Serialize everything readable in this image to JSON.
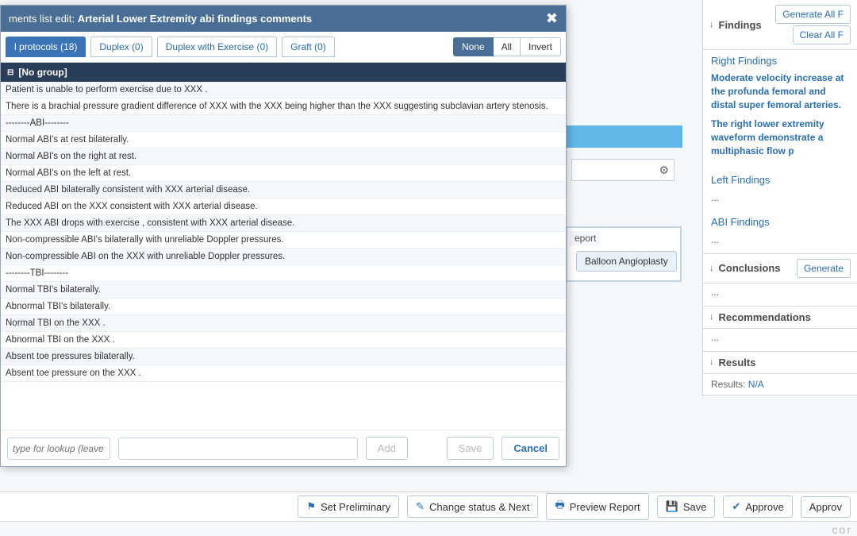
{
  "modal": {
    "title_prefix": "ments list edit: ",
    "title_strong": "Arterial Lower Extremity abi findings comments",
    "tabs": [
      "l protocols (18)",
      "Duplex (0)",
      "Duplex with Exercise (0)",
      "Graft (0)"
    ],
    "seg": [
      "None",
      "All",
      "Invert"
    ],
    "group_label": "[No group]",
    "items": [
      "Patient is unable to perform exercise due to XXX .",
      "There is a brachial pressure gradient difference of XXX with the XXX being higher than the XXX suggesting subclavian artery stenosis.",
      "--------ABI--------",
      "Normal ABI's at rest bilaterally.",
      "Normal ABI's on the right at rest.",
      "Normal ABI's on the left at rest.",
      "Reduced ABI bilaterally consistent with XXX arterial disease.",
      "Reduced ABI on the XXX consistent with XXX arterial disease.",
      "The XXX ABI drops with exercise , consistent with XXX arterial disease.",
      "Non-compressible ABI's bilaterally with unreliable Doppler pressures.",
      "Non-compressible ABI on the XXX with unreliable Doppler pressures.",
      "--------TBI--------",
      "Normal TBI's bilaterally.",
      "Abnormal TBI's bilaterally.",
      "Normal TBI on the XXX .",
      "Abnormal TBI on the XXX .",
      "Absent toe pressures bilaterally.",
      "Absent toe pressure on the XXX ."
    ],
    "lookup_placeholder": "type for lookup (leave blank",
    "add_label": "Add",
    "save_label": "Save",
    "cancel_label": "Cancel"
  },
  "right": {
    "findings_title": "Findings",
    "gen_all": "Generate All F",
    "clear_all": "Clear All F",
    "right_findings": "Right Findings",
    "right_findings_text1": "Moderate velocity increase at the profunda femoral and distal super femoral arteries.",
    "right_findings_text2": "The right lower extremity waveform demonstrate a multiphasic flow p",
    "left_findings": "Left Findings",
    "abi_findings": "ABI Findings",
    "conclusions": "Conclusions",
    "generate": "Generate",
    "recommendations": "Recommendations",
    "results": "Results",
    "results_label": "Results:",
    "results_val": "N/A",
    "dots": "..."
  },
  "background": {
    "balloon": "Balloon Angioplasty",
    "report": "eport"
  },
  "toolbar": {
    "set_preliminary": "Set Preliminary",
    "change_next": "Change status & Next",
    "preview": "Preview Report",
    "save": "Save",
    "approve": "Approve",
    "approve2": "Approv"
  },
  "brand": "cor"
}
